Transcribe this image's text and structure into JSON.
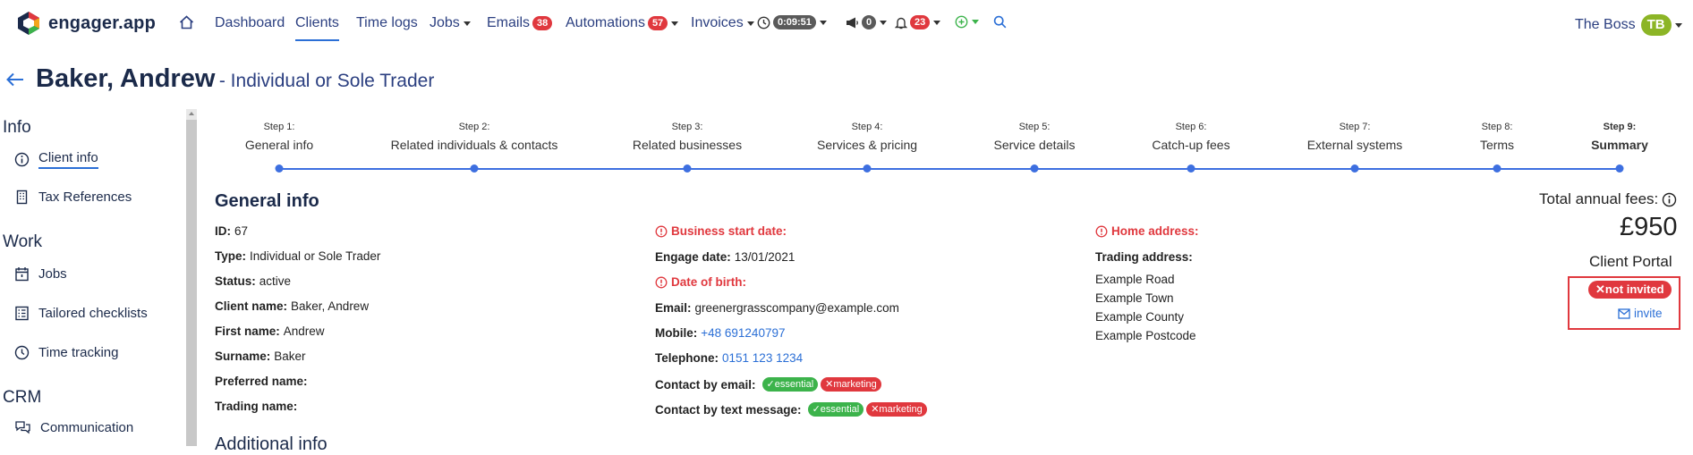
{
  "app": {
    "name": "engager.app"
  },
  "nav": {
    "dashboard": "Dashboard",
    "clients": "Clients",
    "time_logs": "Time logs",
    "jobs": "Jobs",
    "emails": "Emails",
    "emails_count": "38",
    "automations": "Automations",
    "automations_count": "57",
    "invoices": "Invoices",
    "timer": "0:09:51",
    "announcements_count": "0",
    "notifications_count": "23"
  },
  "user": {
    "name": "The Boss",
    "initials": "TB"
  },
  "page": {
    "name": "Baker, Andrew",
    "subtitle": "- Individual or Sole Trader"
  },
  "sidebar": {
    "info_heading": "Info",
    "client_info": "Client info",
    "tax_references": "Tax References",
    "work_heading": "Work",
    "jobs": "Jobs",
    "tailored_checklists": "Tailored checklists",
    "time_tracking": "Time tracking",
    "crm_heading": "CRM",
    "communication": "Communication"
  },
  "steps": [
    {
      "num": "Step 1:",
      "label": "General info"
    },
    {
      "num": "Step 2:",
      "label": "Related individuals & contacts"
    },
    {
      "num": "Step 3:",
      "label": "Related businesses"
    },
    {
      "num": "Step 4:",
      "label": "Services & pricing"
    },
    {
      "num": "Step 5:",
      "label": "Service details"
    },
    {
      "num": "Step 6:",
      "label": "Catch-up fees"
    },
    {
      "num": "Step 7:",
      "label": "External systems"
    },
    {
      "num": "Step 8:",
      "label": "Terms"
    },
    {
      "num": "Step 9:",
      "label": "Summary"
    }
  ],
  "general": {
    "title": "General info",
    "id_label": "ID:",
    "id": "67",
    "type_label": "Type:",
    "type": "Individual or Sole Trader",
    "status_label": "Status:",
    "status": "active",
    "client_name_label": "Client name:",
    "client_name": "Baker, Andrew",
    "first_name_label": "First name:",
    "first_name": "Andrew",
    "surname_label": "Surname:",
    "surname": "Baker",
    "preferred_name_label": "Preferred name:",
    "trading_name_label": "Trading name:",
    "business_start_label": "Business start date:",
    "engage_date_label": "Engage date:",
    "engage_date": "13/01/2021",
    "dob_label": "Date of birth:",
    "email_label": "Email:",
    "email": "greenergrasscompany@example.com",
    "mobile_label": "Mobile:",
    "mobile": "+48 691240797",
    "telephone_label": "Telephone:",
    "telephone": "0151 123 1234",
    "contact_email_label": "Contact by email:",
    "contact_text_label": "Contact by text message:",
    "pill_essential": "essential",
    "pill_marketing": "marketing",
    "home_address_label": "Home address:",
    "trading_address_label": "Trading address:",
    "address": [
      "Example Road",
      "Example Town",
      "Example County",
      "Example Postcode"
    ],
    "additional_title": "Additional info"
  },
  "fees": {
    "label": "Total annual fees:",
    "amount": "£950",
    "portal_label": "Client Portal",
    "not_invited": "not invited",
    "invite": "invite"
  },
  "colors": {
    "accent": "#2b6fd6",
    "danger": "#e0383e",
    "success": "#3cb34b",
    "avatar": "#8cb526"
  }
}
